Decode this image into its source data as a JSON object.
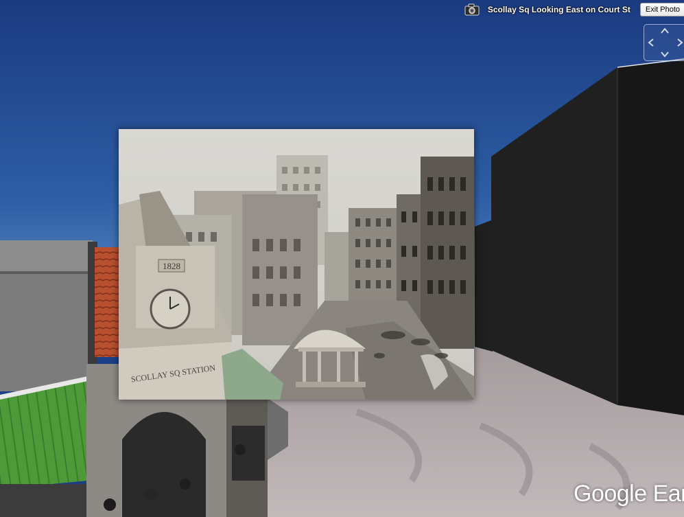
{
  "header": {
    "photo_icon": "camera-icon",
    "photo_title": "Scollay Sq Looking East on Court St",
    "exit_label": "Exit Photo"
  },
  "navigation": {
    "icons": [
      "chevron-up-icon",
      "chevron-down-icon",
      "chevron-left-icon",
      "chevron-right-icon"
    ]
  },
  "photo": {
    "clock_year": "1828",
    "station_sign": "SCOLLAY SQ STATION"
  },
  "branding": {
    "logo_text": "Google Ear"
  },
  "colors": {
    "sky_top": "#1c3f86",
    "sky_bottom": "#5c8fc8",
    "building_dark": "#1a1a1a",
    "ground": "#b3abad",
    "roof_green": "#4f9a3c"
  }
}
